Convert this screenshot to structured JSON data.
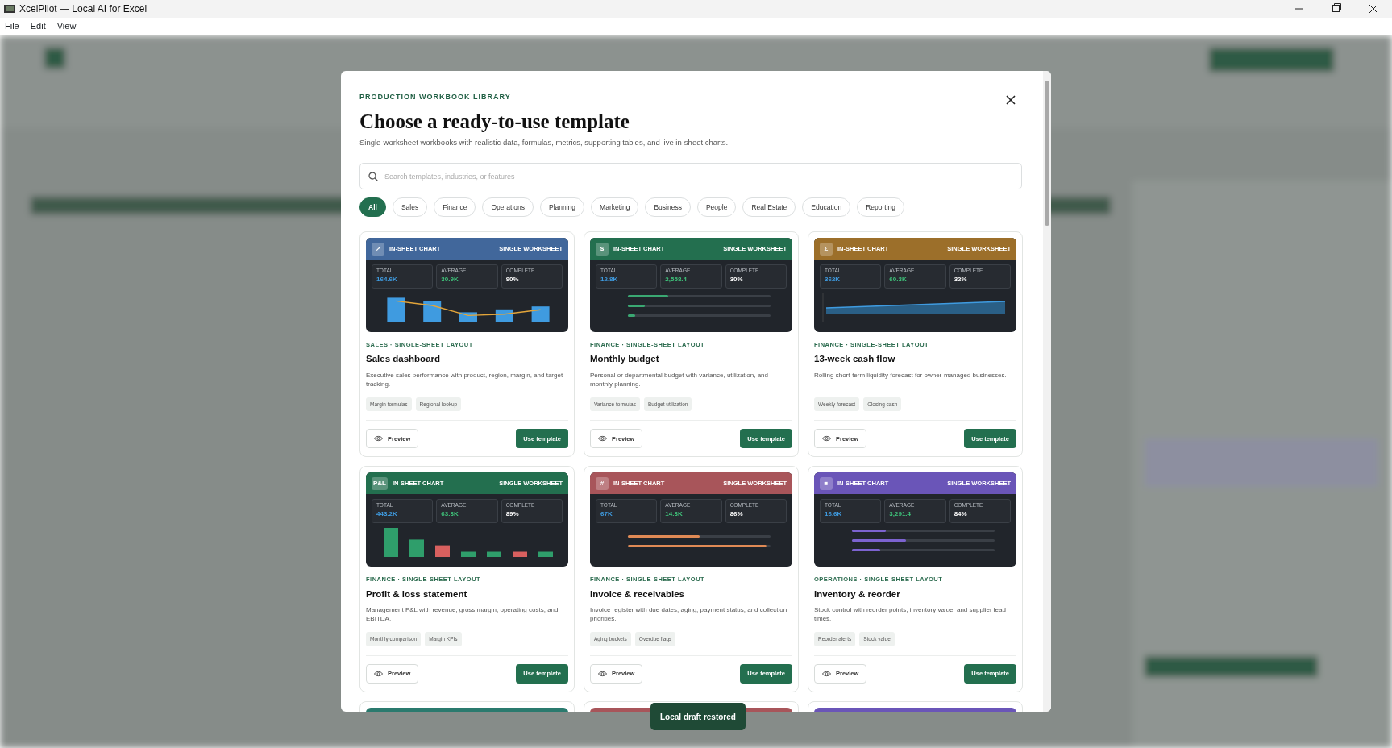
{
  "window": {
    "title": "XcelPilot — Local AI for Excel"
  },
  "menu": [
    "File",
    "Edit",
    "View"
  ],
  "modal": {
    "eyebrow": "PRODUCTION WORKBOOK LIBRARY",
    "title": "Choose a ready-to-use template",
    "subtitle": "Single-worksheet workbooks with realistic data, formulas, metrics, supporting tables, and live in-sheet charts.",
    "search": {
      "placeholder": "Search templates, industries, or features"
    },
    "filters": [
      {
        "label": "All",
        "selected": true
      },
      {
        "label": "Sales",
        "selected": false
      },
      {
        "label": "Finance",
        "selected": false
      },
      {
        "label": "Operations",
        "selected": false
      },
      {
        "label": "Planning",
        "selected": false
      },
      {
        "label": "Marketing",
        "selected": false
      },
      {
        "label": "Business",
        "selected": false
      },
      {
        "label": "People",
        "selected": false
      },
      {
        "label": "Real Estate",
        "selected": false
      },
      {
        "label": "Education",
        "selected": false
      },
      {
        "label": "Reporting",
        "selected": false
      }
    ],
    "cards": [
      {
        "color": "#41679b",
        "icon": "↗",
        "header_left": "IN-SHEET CHART",
        "header_right": "SINGLE WORKSHEET",
        "stats": [
          {
            "label": "TOTAL",
            "value": "164.6K"
          },
          {
            "label": "AVERAGE",
            "value": "30.9K"
          },
          {
            "label": "COMPLETE",
            "value": "90%"
          }
        ],
        "chart": {
          "kind": "bars_line"
        },
        "category": "SALES · SINGLE-SHEET LAYOUT",
        "title": "Sales dashboard",
        "description": "Executive sales performance with product, region, margin, and target tracking.",
        "tags": [
          "Margin formulas",
          "Regional lookup"
        ],
        "preview": "Preview",
        "action": "Use template"
      },
      {
        "color": "#236f4f",
        "icon": "$",
        "header_left": "IN-SHEET CHART",
        "header_right": "SINGLE WORKSHEET",
        "stats": [
          {
            "label": "TOTAL",
            "value": "12.8K"
          },
          {
            "label": "AVERAGE",
            "value": "2,558.4"
          },
          {
            "label": "COMPLETE",
            "value": "30%"
          }
        ],
        "chart": {
          "kind": "progress",
          "color": "#3aa872",
          "bars": [
            {
              "level": 0.28
            },
            {
              "level": 0.12
            },
            {
              "level": 0.05
            }
          ]
        },
        "category": "FINANCE · SINGLE-SHEET LAYOUT",
        "title": "Monthly budget",
        "description": "Personal or departmental budget with variance, utilization, and monthly planning.",
        "tags": [
          "Variance formulas",
          "Budget utilization"
        ],
        "preview": "Preview",
        "action": "Use template"
      },
      {
        "color": "#9c6f2a",
        "icon": "Σ",
        "header_left": "IN-SHEET CHART",
        "header_right": "SINGLE WORKSHEET",
        "stats": [
          {
            "label": "TOTAL",
            "value": "362K"
          },
          {
            "label": "AVERAGE",
            "value": "60.3K"
          },
          {
            "label": "COMPLETE",
            "value": "32%"
          }
        ],
        "chart": {
          "kind": "area"
        },
        "category": "FINANCE · SINGLE-SHEET LAYOUT",
        "title": "13-week cash flow",
        "description": "Rolling short-term liquidity forecast for owner-managed businesses.",
        "tags": [
          "Weekly forecast",
          "Closing cash"
        ],
        "preview": "Preview",
        "action": "Use template"
      },
      {
        "color": "#236f4f",
        "icon": "P&L",
        "header_left": "IN-SHEET CHART",
        "header_right": "SINGLE WORKSHEET",
        "stats": [
          {
            "label": "TOTAL",
            "value": "443.2K"
          },
          {
            "label": "AVERAGE",
            "value": "63.3K"
          },
          {
            "label": "COMPLETE",
            "value": "89%"
          }
        ],
        "chart": {
          "kind": "bars"
        },
        "category": "FINANCE · SINGLE-SHEET LAYOUT",
        "title": "Profit & loss statement",
        "description": "Management P&L with revenue, gross margin, operating costs, and EBITDA.",
        "tags": [
          "Monthly comparison",
          "Margin KPIs"
        ],
        "preview": "Preview",
        "action": "Use template"
      },
      {
        "color": "#a8555a",
        "icon": "#",
        "header_left": "IN-SHEET CHART",
        "header_right": "SINGLE WORKSHEET",
        "stats": [
          {
            "label": "TOTAL",
            "value": "67K"
          },
          {
            "label": "AVERAGE",
            "value": "14.3K"
          },
          {
            "label": "COMPLETE",
            "value": "86%"
          }
        ],
        "chart": {
          "kind": "progress",
          "color": "#e08a55",
          "bars": [
            {
              "level": 0.5
            },
            {
              "level": 0.97
            }
          ]
        },
        "category": "FINANCE · SINGLE-SHEET LAYOUT",
        "title": "Invoice & receivables",
        "description": "Invoice register with due dates, aging, payment status, and collection priorities.",
        "tags": [
          "Aging buckets",
          "Overdue flags"
        ],
        "preview": "Preview",
        "action": "Use template"
      },
      {
        "color": "#6a55b8",
        "icon": "■",
        "header_left": "IN-SHEET CHART",
        "header_right": "SINGLE WORKSHEET",
        "stats": [
          {
            "label": "TOTAL",
            "value": "16.6K"
          },
          {
            "label": "AVERAGE",
            "value": "3,291.4"
          },
          {
            "label": "COMPLETE",
            "value": "84%"
          }
        ],
        "chart": {
          "kind": "progress",
          "color": "#7c63d0",
          "bars": [
            {
              "level": 0.24
            },
            {
              "level": 0.38
            },
            {
              "level": 0.2
            }
          ]
        },
        "category": "OPERATIONS · SINGLE-SHEET LAYOUT",
        "title": "Inventory & reorder",
        "description": "Stock control with reorder points, inventory value, and supplier lead times.",
        "tags": [
          "Reorder alerts",
          "Stock value"
        ],
        "preview": "Preview",
        "action": "Use template"
      }
    ],
    "partial_cards": [
      {
        "color": "#2a7a6e"
      },
      {
        "color": "#a8555a"
      },
      {
        "color": "#6a55b8"
      }
    ]
  },
  "toast": "Local draft restored"
}
